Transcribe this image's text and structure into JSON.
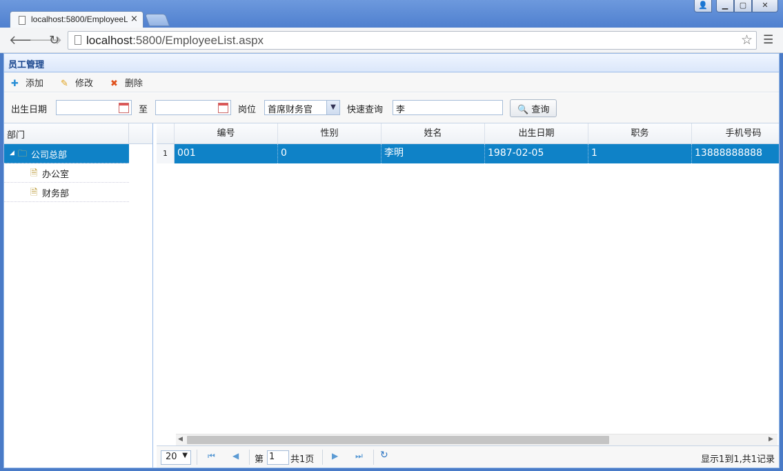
{
  "browser": {
    "tab_title": "localhost:5800/EmployeeList.aspx",
    "tab_close": "×",
    "address_host": "localhost",
    "address_rest": ":5800/EmployeeList.aspx",
    "window_buttons": {
      "user": "👤",
      "minimize": "▁",
      "maximize": "▢",
      "close": "✕"
    }
  },
  "panel": {
    "title": "员工管理"
  },
  "actions": [
    {
      "label": "添加",
      "icon": "plus-icon",
      "glyph": "✚",
      "color": "#2a8fd6"
    },
    {
      "label": "修改",
      "icon": "pencil-icon",
      "glyph": "✎",
      "color": "#e1a11a"
    },
    {
      "label": "删除",
      "icon": "delete-icon",
      "glyph": "✖",
      "color": "#e0521e"
    }
  ],
  "filters": {
    "birth_label": "出生日期",
    "birth_from": "",
    "to_label": "至",
    "birth_to": "",
    "position_label": "岗位",
    "position_value": "首席财务官",
    "quick_label": "快速查询",
    "quick_value": "李",
    "search_button": "查询"
  },
  "tree": {
    "header": "部门",
    "nodes": [
      {
        "label": "公司总部",
        "selected": true,
        "level": 0,
        "icon": "folder-icon"
      },
      {
        "label": "办公室",
        "selected": false,
        "level": 1,
        "icon": "document-icon"
      },
      {
        "label": "财务部",
        "selected": false,
        "level": 1,
        "icon": "document-icon"
      }
    ]
  },
  "grid": {
    "columns": [
      "编号",
      "性别",
      "姓名",
      "出生日期",
      "职务",
      "手机号码"
    ],
    "rows": [
      {
        "num": "1",
        "cells": [
          "001",
          "0",
          "李明",
          "1987-02-05",
          "1",
          "13888888888"
        ]
      }
    ]
  },
  "pager": {
    "page_size": "20",
    "page_prefix": "第",
    "page_value": "1",
    "page_total": "共1页",
    "summary": "显示1到1,共1记录"
  }
}
